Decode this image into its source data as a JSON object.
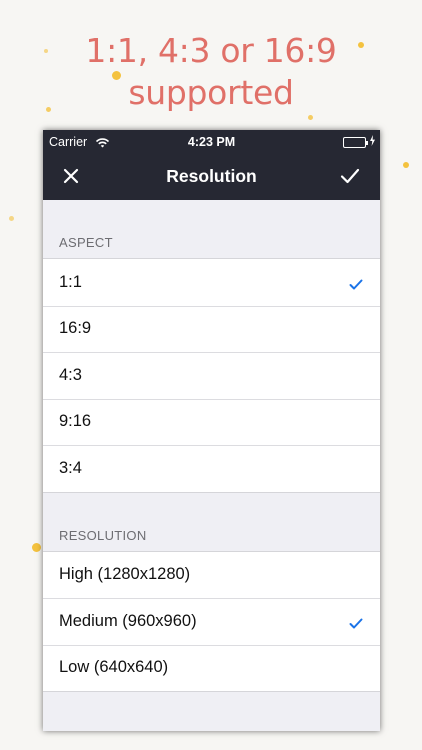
{
  "headline": {
    "line1": "1:1, 4:3 or 16:9",
    "line2": "supported"
  },
  "statusbar": {
    "carrier": "Carrier",
    "time": "4:23 PM"
  },
  "navbar": {
    "title": "Resolution"
  },
  "aspect": {
    "header": "ASPECT",
    "items": [
      {
        "label": "1:1",
        "selected": true
      },
      {
        "label": "16:9",
        "selected": false
      },
      {
        "label": "4:3",
        "selected": false
      },
      {
        "label": "9:16",
        "selected": false
      },
      {
        "label": "3:4",
        "selected": false
      }
    ]
  },
  "resolution": {
    "header": "RESOLUTION",
    "items": [
      {
        "label": "High (1280x1280)",
        "selected": false
      },
      {
        "label": "Medium (960x960)",
        "selected": true
      },
      {
        "label": "Low (640x640)",
        "selected": false
      }
    ]
  },
  "colors": {
    "headline": "#e07068",
    "bar": "#262833",
    "check": "#1a73e8",
    "battery": "#4cd964"
  }
}
